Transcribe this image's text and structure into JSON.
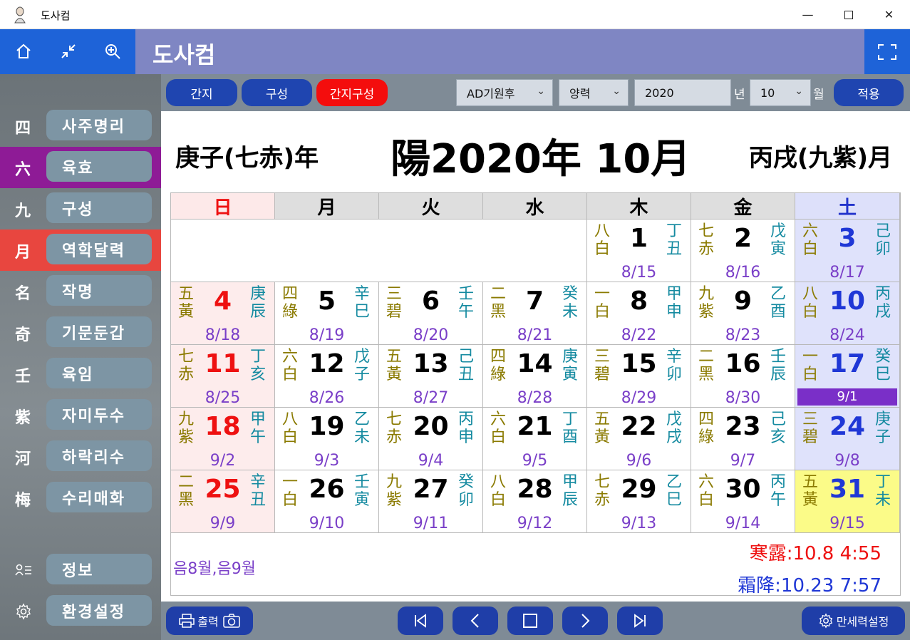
{
  "window": {
    "title": "도사컴"
  },
  "header": {
    "title": "도사컴"
  },
  "sidebar": {
    "items": [
      {
        "hanja": "四",
        "label": "사주명리"
      },
      {
        "hanja": "六",
        "label": "육효"
      },
      {
        "hanja": "九",
        "label": "구성"
      },
      {
        "hanja": "月",
        "label": "역학달력"
      },
      {
        "hanja": "名",
        "label": "작명"
      },
      {
        "hanja": "奇",
        "label": "기문둔갑"
      },
      {
        "hanja": "壬",
        "label": "육임"
      },
      {
        "hanja": "紫",
        "label": "자미두수"
      },
      {
        "hanja": "河",
        "label": "하락리수"
      },
      {
        "hanja": "梅",
        "label": "수리매화"
      }
    ],
    "info_label": "정보",
    "settings_label": "환경설정"
  },
  "toolbar": {
    "tab_ganji": "간지",
    "tab_gusung": "구성",
    "tab_ganji_gusung": "간지구성",
    "era_select": "AD기원후",
    "calendar_select": "양력",
    "year_value": "2020",
    "year_suffix": "년",
    "month_select": "10",
    "month_suffix": "월",
    "apply_label": "적용"
  },
  "calendar": {
    "year_ganji": "庚子(七赤)年",
    "title": "陽2020年 10月",
    "month_ganji": "丙戌(九紫)月",
    "weekdays": [
      "日",
      "月",
      "火",
      "水",
      "木",
      "金",
      "土"
    ],
    "weeks": [
      [
        null,
        null,
        null,
        null,
        {
          "day": "1",
          "star": "八白",
          "gz": "丁丑",
          "lunar": "8/15"
        },
        {
          "day": "2",
          "star": "七赤",
          "gz": "戊寅",
          "lunar": "8/16"
        },
        {
          "day": "3",
          "star": "六白",
          "gz": "己卯",
          "lunar": "8/17"
        }
      ],
      [
        {
          "day": "4",
          "star": "五黃",
          "gz": "庚辰",
          "lunar": "8/18"
        },
        {
          "day": "5",
          "star": "四綠",
          "gz": "辛巳",
          "lunar": "8/19"
        },
        {
          "day": "6",
          "star": "三碧",
          "gz": "壬午",
          "lunar": "8/20"
        },
        {
          "day": "7",
          "star": "二黑",
          "gz": "癸未",
          "lunar": "8/21"
        },
        {
          "day": "8",
          "star": "一白",
          "gz": "甲申",
          "lunar": "8/22"
        },
        {
          "day": "9",
          "star": "九紫",
          "gz": "乙酉",
          "lunar": "8/23"
        },
        {
          "day": "10",
          "star": "八白",
          "gz": "丙戌",
          "lunar": "8/24"
        }
      ],
      [
        {
          "day": "11",
          "star": "七赤",
          "gz": "丁亥",
          "lunar": "8/25"
        },
        {
          "day": "12",
          "star": "六白",
          "gz": "戊子",
          "lunar": "8/26"
        },
        {
          "day": "13",
          "star": "五黃",
          "gz": "己丑",
          "lunar": "8/27"
        },
        {
          "day": "14",
          "star": "四綠",
          "gz": "庚寅",
          "lunar": "8/28"
        },
        {
          "day": "15",
          "star": "三碧",
          "gz": "辛卯",
          "lunar": "8/29"
        },
        {
          "day": "16",
          "star": "二黑",
          "gz": "壬辰",
          "lunar": "8/30"
        },
        {
          "day": "17",
          "star": "一白",
          "gz": "癸巳",
          "lunar": "9/1",
          "highlight": true
        }
      ],
      [
        {
          "day": "18",
          "star": "九紫",
          "gz": "甲午",
          "lunar": "9/2"
        },
        {
          "day": "19",
          "star": "八白",
          "gz": "乙未",
          "lunar": "9/3"
        },
        {
          "day": "20",
          "star": "七赤",
          "gz": "丙申",
          "lunar": "9/4"
        },
        {
          "day": "21",
          "star": "六白",
          "gz": "丁酉",
          "lunar": "9/5"
        },
        {
          "day": "22",
          "star": "五黃",
          "gz": "戊戌",
          "lunar": "9/6"
        },
        {
          "day": "23",
          "star": "四綠",
          "gz": "己亥",
          "lunar": "9/7"
        },
        {
          "day": "24",
          "star": "三碧",
          "gz": "庚子",
          "lunar": "9/8"
        }
      ],
      [
        {
          "day": "25",
          "star": "二黑",
          "gz": "辛丑",
          "lunar": "9/9"
        },
        {
          "day": "26",
          "star": "一白",
          "gz": "壬寅",
          "lunar": "9/10"
        },
        {
          "day": "27",
          "star": "九紫",
          "gz": "癸卯",
          "lunar": "9/11"
        },
        {
          "day": "28",
          "star": "八白",
          "gz": "甲辰",
          "lunar": "9/12"
        },
        {
          "day": "29",
          "star": "七赤",
          "gz": "乙巳",
          "lunar": "9/13"
        },
        {
          "day": "30",
          "star": "六白",
          "gz": "丙午",
          "lunar": "9/14"
        },
        {
          "day": "31",
          "star": "五黃",
          "gz": "丁未",
          "lunar": "9/15",
          "today": true
        }
      ]
    ],
    "lunar_months": "음8월,음9월",
    "solar_term_1": "寒露:10.8 4:55",
    "solar_term_2": "霜降:10.23 7:57"
  },
  "bottombar": {
    "print_label": "출력",
    "settings_label": "만세력설정"
  },
  "colors": {
    "accent_blue": "#1f45b0",
    "active_red": "#f40d0d",
    "sidebar_purple": "#8e1b96",
    "sidebar_red": "#e8463f"
  }
}
